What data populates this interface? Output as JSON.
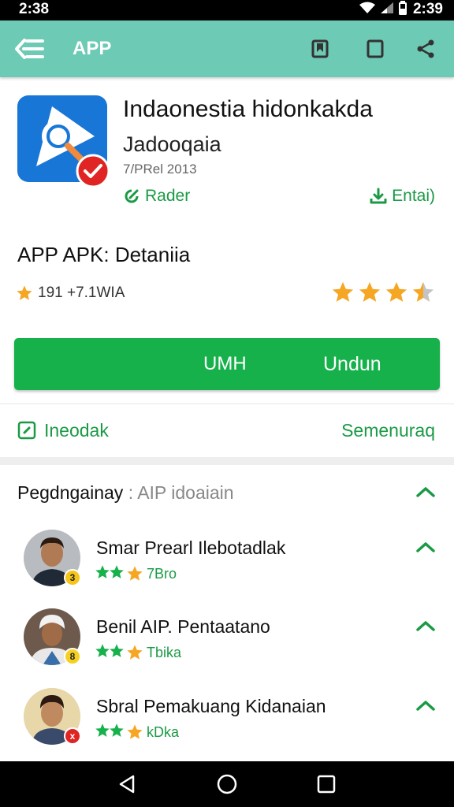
{
  "status_bar": {
    "time_left": "2:38",
    "time_right": "2:39"
  },
  "app_bar": {
    "title": "APP"
  },
  "app": {
    "name": "Indaonestia hidonkakda",
    "subtitle": "Jadooqaia",
    "meta": "7/PRel 2013",
    "rader_label": "Rader",
    "entai_label": "Entai)"
  },
  "detail": {
    "title": "APP APK: Detaniia",
    "rating_text": "191 +7.1WIA",
    "stars": 3.5
  },
  "install": {
    "label_left": "UMH",
    "label_right": "Undun"
  },
  "links": {
    "left": "Ineodak",
    "right": "Semenuraq"
  },
  "reviews": {
    "title_strong": "Pegdngainay",
    "title_sep": ":",
    "title_muted": "AIP idoaiain",
    "items": [
      {
        "name": "Smar Prearl Ilebotadlak",
        "rating_text": "7Bro",
        "badge": "3"
      },
      {
        "name": "Benil AIP. Pentaatano",
        "rating_text": "Tbika",
        "badge": "8"
      },
      {
        "name": "Sbral Pemakuang Kidanaian",
        "rating_text": "kDka",
        "badge": "x"
      }
    ]
  },
  "colors": {
    "app_bar": "#6dcab4",
    "accent_green": "#17b14c",
    "link_green": "#1a9a45",
    "star_orange": "#f5a623",
    "star_gray": "#c4c4c4",
    "app_icon_blue": "#1877d6"
  }
}
